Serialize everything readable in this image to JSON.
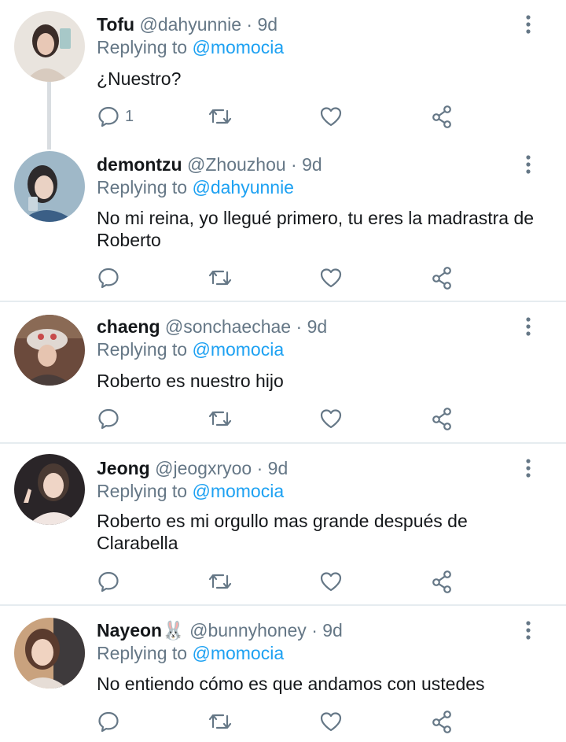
{
  "tweets": [
    {
      "name": "Tofu",
      "name_emoji": "",
      "handle": "@dahyunnie",
      "separator": "·",
      "time": "9d",
      "replying_prefix": "Replying to",
      "reply_to": "@momocia",
      "text": "¿Nuestro?",
      "reply_count": "1",
      "avatar_colors": [
        "#e9e4de",
        "#3a2c28"
      ]
    },
    {
      "name": "demontzu",
      "name_emoji": "",
      "handle": "@Zhouzhou",
      "separator": "·",
      "time": "9d",
      "replying_prefix": "Replying to",
      "reply_to": "@dahyunnie",
      "text": "No mi reina, yo llegué primero, tu eres la madrastra de Roberto",
      "reply_count": "",
      "avatar_colors": [
        "#9fb8c8",
        "#2d2a2c"
      ]
    },
    {
      "name": "chaeng",
      "name_emoji": "",
      "handle": "@sonchaechae",
      "separator": "·",
      "time": "9d",
      "replying_prefix": "Replying to",
      "reply_to": "@momocia",
      "text": "Roberto es nuestro hijo",
      "reply_count": "",
      "avatar_colors": [
        "#6b4a3c",
        "#e0d8d2"
      ]
    },
    {
      "name": "Jeong",
      "name_emoji": "",
      "handle": "@jeogxryoo",
      "separator": "·",
      "time": "9d",
      "replying_prefix": "Replying to",
      "reply_to": "@momocia",
      "text": "Roberto es mi orgullo mas grande después de Clarabella",
      "reply_count": "",
      "avatar_colors": [
        "#2a2528",
        "#f1e6e2"
      ]
    },
    {
      "name": "Nayeon",
      "name_emoji": "🐰",
      "handle": "@bunnyhoney",
      "separator": "·",
      "time": "9d",
      "replying_prefix": "Replying to",
      "reply_to": "@momocia",
      "text": "No entiendo cómo es que andamos con ustedes",
      "reply_count": "",
      "avatar_colors": [
        "#c9a27e",
        "#5a3b2e"
      ]
    }
  ],
  "icons": {
    "reply": "reply-icon",
    "retweet": "retweet-icon",
    "like": "heart-icon",
    "share": "share-icon",
    "more": "more-icon"
  },
  "colors": {
    "icon": "#657786",
    "link": "#1da1f2",
    "divider": "#e6ecf0"
  }
}
